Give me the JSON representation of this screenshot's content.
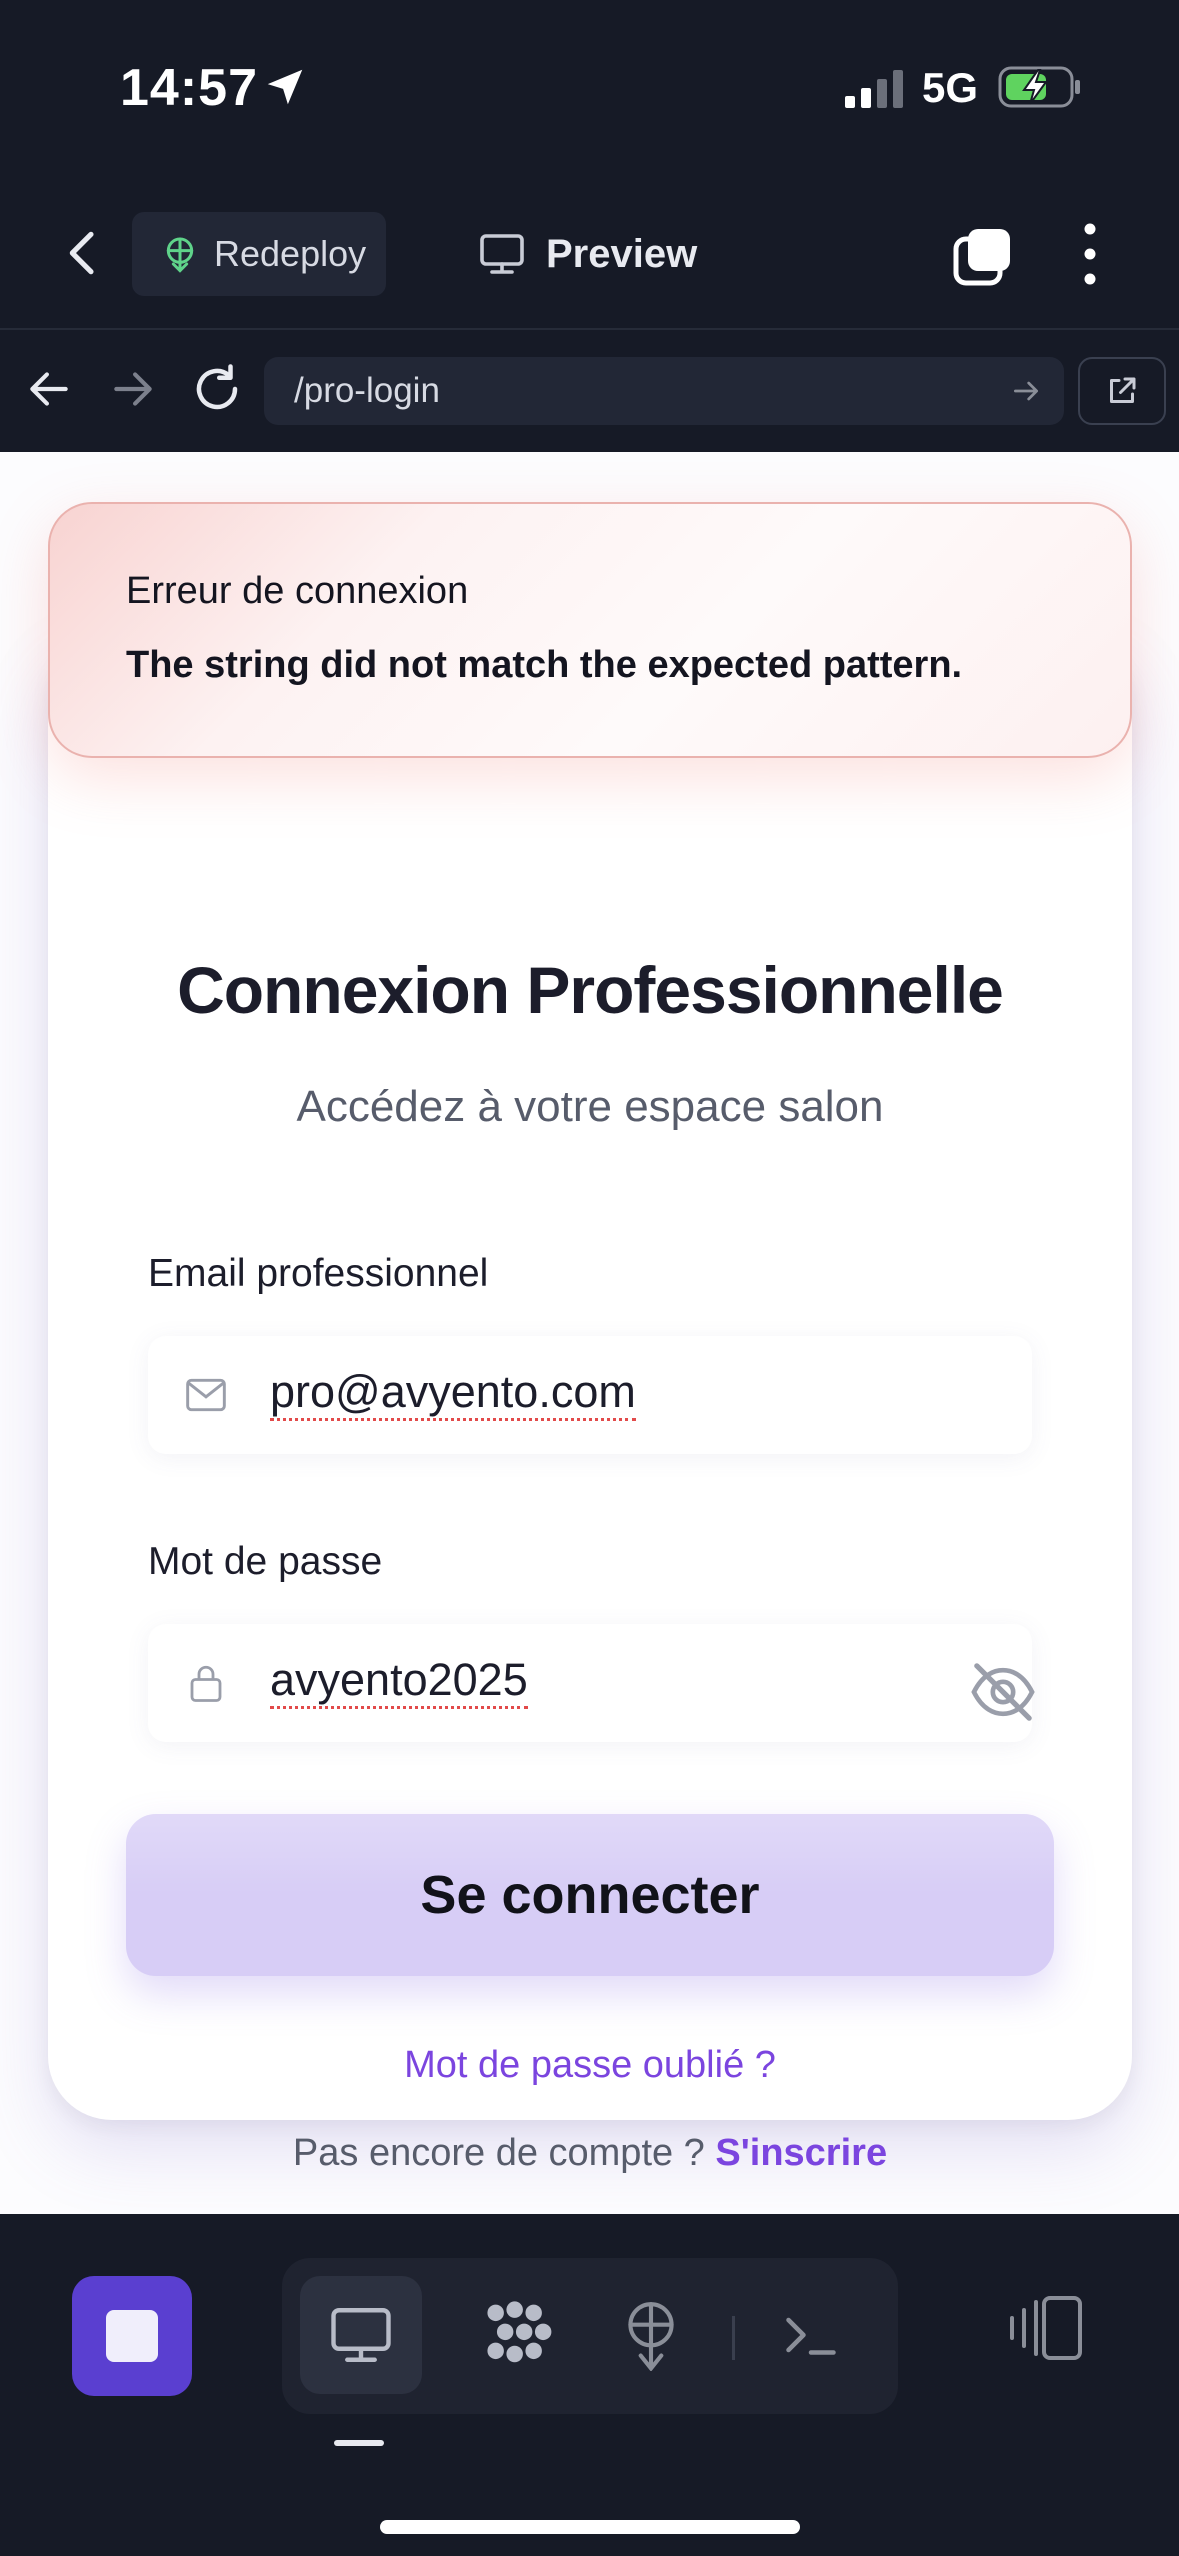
{
  "status_bar": {
    "time": "14:57",
    "network": "5G",
    "icons": [
      "location-arrow-icon",
      "cellular-signal-icon",
      "battery-charging-icon"
    ]
  },
  "app_bar": {
    "redeploy_label": "Redeploy",
    "preview_label": "Preview",
    "icons": [
      "chevron-left-icon",
      "deploy-icon",
      "monitor-icon",
      "tabs-icon",
      "more-vertical-icon"
    ]
  },
  "url_bar": {
    "url": "/pro-login",
    "icons": [
      "arrow-left-icon",
      "arrow-right-icon",
      "reload-icon",
      "go-arrow-icon",
      "external-link-icon"
    ]
  },
  "error_toast": {
    "title": "Erreur de connexion",
    "message": "The string did not match the expected pattern."
  },
  "login": {
    "title": "Connexion Professionnelle",
    "subtitle": "Accédez à votre espace salon",
    "email_label": "Email professionnel",
    "email_value": "pro@avyento.com",
    "password_label": "Mot de passe",
    "password_value": "avyento2025",
    "submit_label": "Se connecter",
    "forgot_label": "Mot de passe oublié ?",
    "no_account_label": "Pas encore de compte ?",
    "signup_label": "S'inscrire"
  },
  "colors": {
    "accent": "#7b45df",
    "button_bg": "#d7cdf6",
    "stop_button": "#5a3fd0",
    "chrome_bg": "#161a26",
    "error_border": "#eab2ae"
  },
  "bottom_bar": {
    "icons": [
      "stop-icon",
      "monitor-icon",
      "apps-icon",
      "deploy-icon",
      "terminal-icon",
      "layout-toggle-icon"
    ]
  }
}
